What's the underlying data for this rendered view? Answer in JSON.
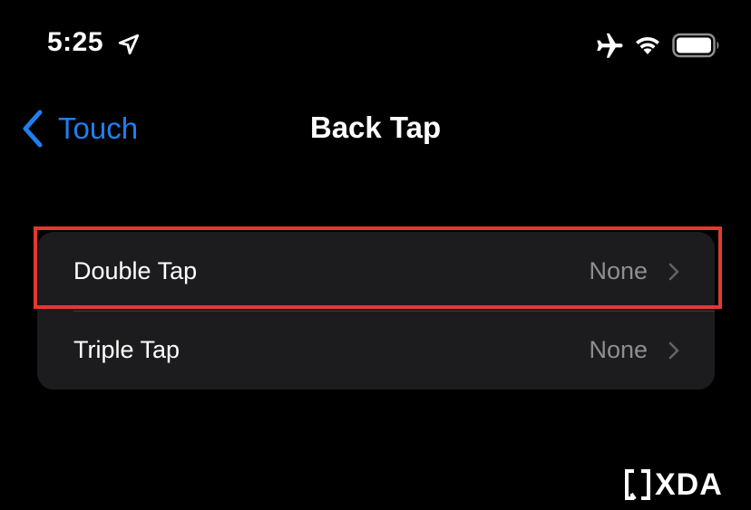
{
  "status_bar": {
    "time": "5:25",
    "icons": [
      "location-icon",
      "airplane-icon",
      "wifi-icon",
      "battery-icon"
    ]
  },
  "nav": {
    "back_label": "Touch",
    "title": "Back Tap",
    "accent_color": "#1f7ff0"
  },
  "settings": {
    "rows": [
      {
        "label": "Double Tap",
        "value": "None"
      },
      {
        "label": "Triple Tap",
        "value": "None"
      }
    ]
  },
  "annotation": {
    "highlight_color": "#e3382f"
  },
  "watermark": {
    "text": "XDA"
  }
}
